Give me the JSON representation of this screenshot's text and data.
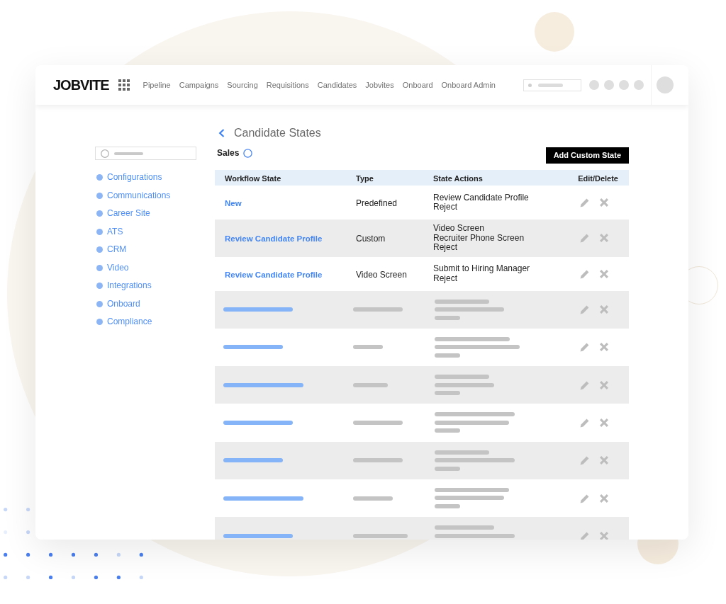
{
  "header": {
    "logo": "JOBVITE",
    "nav": [
      "Pipeline",
      "Campaigns",
      "Sourcing",
      "Requisitions",
      "Candidates",
      "Jobvites",
      "Onboard",
      "Onboard Admin"
    ]
  },
  "sidebar": {
    "items": [
      "Configurations",
      "Communications",
      "Career Site",
      "ATS",
      "CRM",
      "Video",
      "Integrations",
      "Onboard",
      "Compliance"
    ]
  },
  "page": {
    "title": "Candidate States",
    "workflow": "Sales",
    "button": "Add Custom State"
  },
  "table": {
    "columns": [
      "Workflow State",
      "Type",
      "State Actions",
      "Edit/Delete"
    ],
    "rows": [
      {
        "kind": "text",
        "workflow_state": "New",
        "type": "Predefined",
        "state_actions": [
          "Review Candidate Profile",
          "Reject"
        ]
      },
      {
        "kind": "text",
        "workflow_state": "Review Candidate Profile",
        "type": "Custom",
        "state_actions": [
          "Video Screen",
          "Recruiter Phone Screen",
          "Reject"
        ]
      },
      {
        "kind": "text",
        "workflow_state": "Review Candidate Profile",
        "type": "Video Screen",
        "state_actions": [
          "Submit to Hiring Manager",
          "Reject"
        ]
      },
      {
        "kind": "placeholder"
      },
      {
        "kind": "placeholder"
      },
      {
        "kind": "placeholder"
      },
      {
        "kind": "placeholder"
      },
      {
        "kind": "placeholder"
      },
      {
        "kind": "placeholder"
      },
      {
        "kind": "placeholder"
      }
    ]
  }
}
